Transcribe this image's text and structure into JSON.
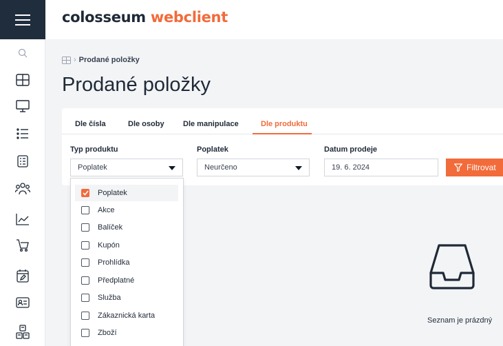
{
  "brand": {
    "part1": "colosseum",
    "part2": "webclient"
  },
  "breadcrumb": {
    "current": "Prodané položky"
  },
  "page": {
    "title": "Prodané položky"
  },
  "tabs": [
    {
      "label": "Dle čísla"
    },
    {
      "label": "Dle osoby"
    },
    {
      "label": "Dle manipulace"
    },
    {
      "label": "Dle produktu"
    }
  ],
  "filters": {
    "type": {
      "label": "Typ produktu",
      "value": "Poplatek"
    },
    "fee": {
      "label": "Poplatek",
      "value": "Neurčeno"
    },
    "date": {
      "label": "Datum prodeje",
      "value": "19. 6. 2024"
    },
    "button_label": "Filtrovat"
  },
  "dropdown": {
    "options": [
      {
        "label": "Poplatek",
        "checked": true
      },
      {
        "label": "Akce",
        "checked": false
      },
      {
        "label": "Balíček",
        "checked": false
      },
      {
        "label": "Kupón",
        "checked": false
      },
      {
        "label": "Prohlídka",
        "checked": false
      },
      {
        "label": "Předplatné",
        "checked": false
      },
      {
        "label": "Služba",
        "checked": false
      },
      {
        "label": "Zákaznická karta",
        "checked": false
      },
      {
        "label": "Zboží",
        "checked": false
      }
    ]
  },
  "empty": {
    "text": "Seznam je prázdný"
  },
  "sidebar": {
    "icons": [
      "search-icon",
      "dashboard-grid-icon",
      "monitor-icon",
      "list-icon",
      "document-list-icon",
      "users-icon",
      "chart-line-icon",
      "cart-icon",
      "calendar-edit-icon",
      "id-card-icon",
      "tickets-icon"
    ]
  },
  "colors": {
    "accent": "#f26b3a",
    "nav_dark": "#1f2d3d"
  }
}
